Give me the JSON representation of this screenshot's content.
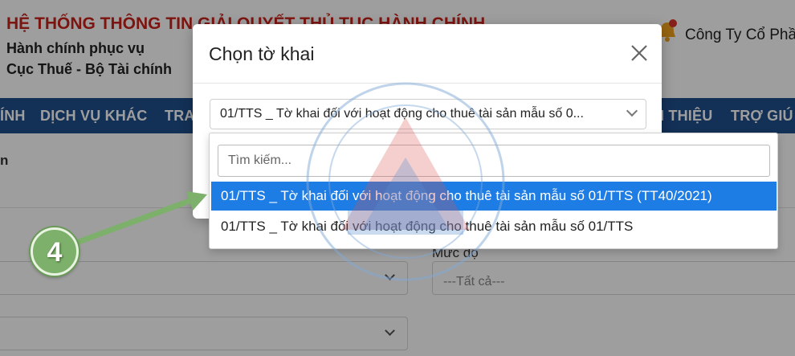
{
  "header": {
    "title": "HỆ THỐNG THÔNG TIN GIẢI QUYẾT THỦ TỤC HÀNH CHÍNH",
    "subtitle1": "Hành chính phục vụ",
    "subtitle2": "Cục Thuế - Bộ Tài chính",
    "company": "Công Ty Cổ Phầ"
  },
  "nav": {
    "items": [
      "ÍNH",
      "DỊCH VỤ KHÁC",
      "TRA",
      "I THIỆU",
      "TRỢ GIÚ"
    ]
  },
  "page": {
    "section_fragment": "n",
    "mucdo_label": "Mức độ",
    "mucdo_placeholder": "---Tất cả---"
  },
  "modal": {
    "title": "Chọn tờ khai",
    "selected_value": "01/TTS _ Tờ khai đối với hoạt động cho thuê tài sản mẫu số 0..."
  },
  "dropdown": {
    "search_placeholder": "Tìm kiếm...",
    "options": [
      "01/TTS _ Tờ khai đối với hoạt động cho thuê tài sản mẫu số 01/TTS (TT40/2021)",
      "01/TTS _ Tờ khai đối với hoạt động cho thuê tài sản mẫu số 01/TTS"
    ]
  },
  "annotation": {
    "step_number": "4"
  },
  "colors": {
    "header_red": "#c8221b",
    "nav_blue": "#1f4e8c",
    "selected_option": "#1e7de4",
    "badge_green": "#7db06a"
  }
}
